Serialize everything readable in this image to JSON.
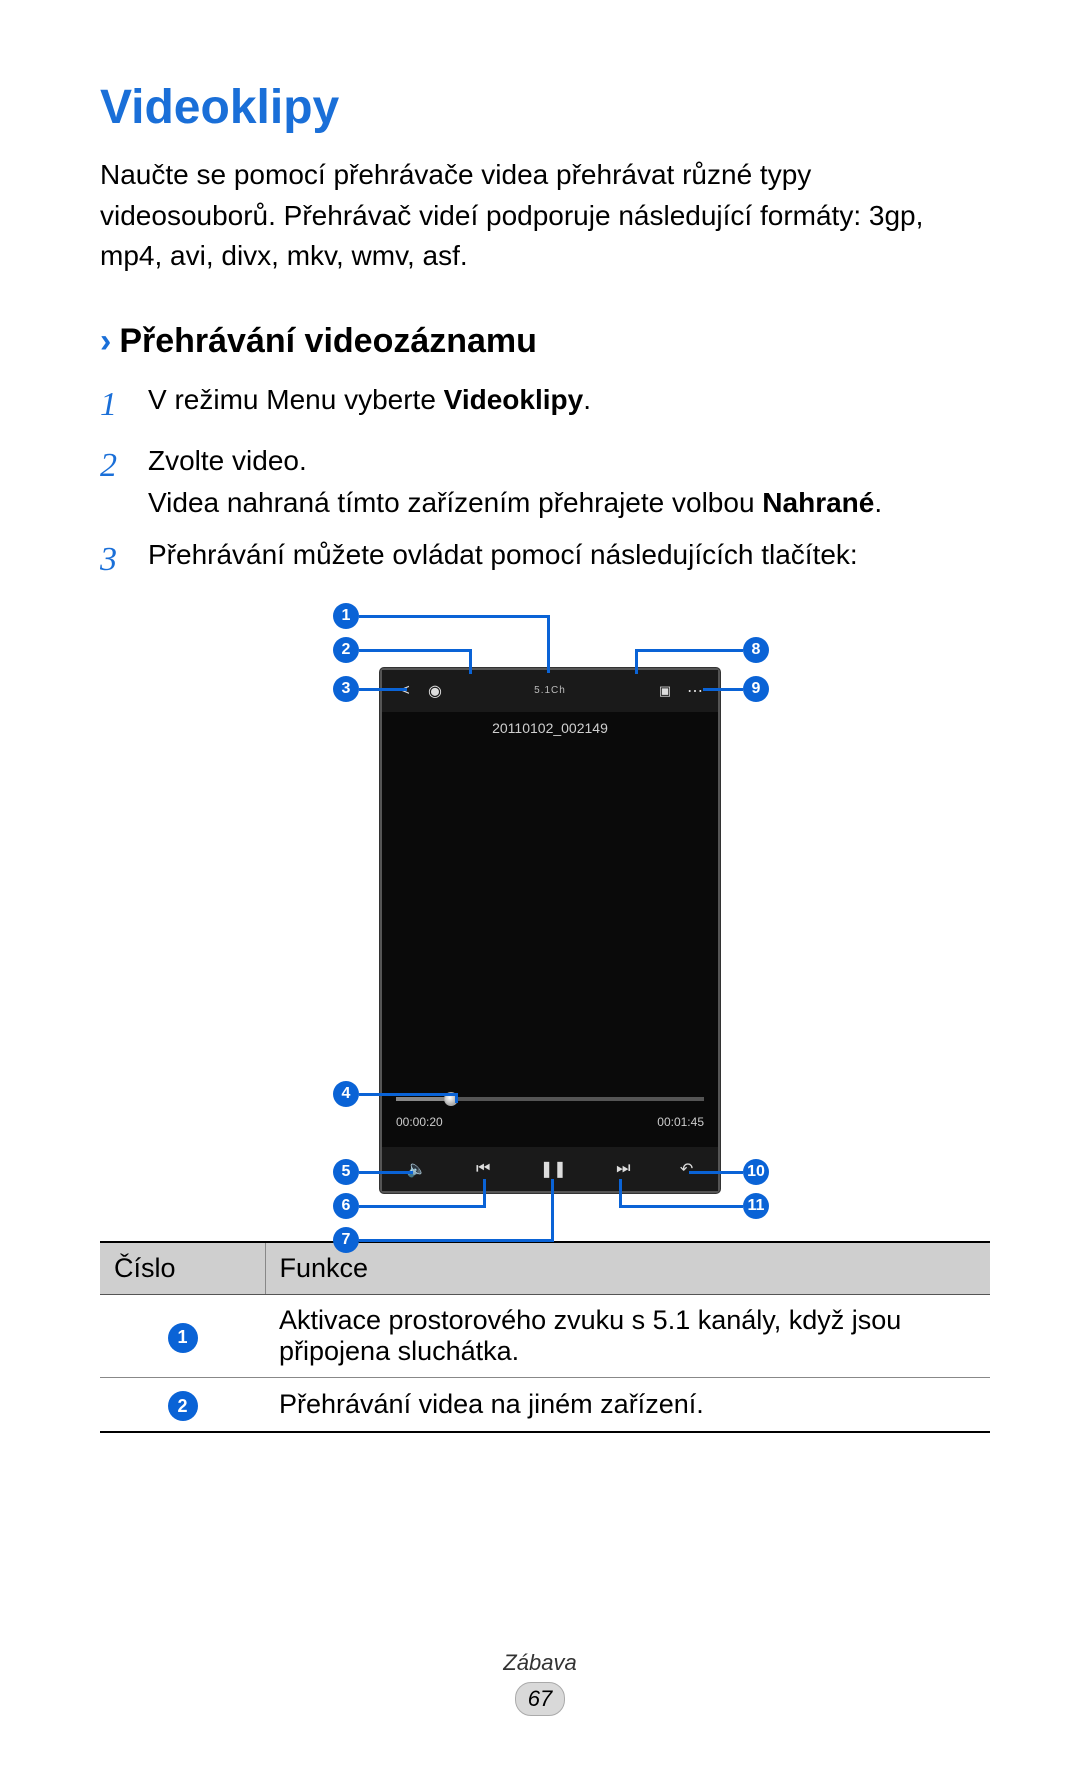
{
  "title": "Videoklipy",
  "intro": "Naučte se pomocí přehrávače videa přehrávat různé typy videosouborů. Přehrávač videí podporuje následující formáty: 3gp, mp4, avi, divx, mkv, wmv, asf.",
  "subhead": "Přehrávání videozáznamu",
  "steps": {
    "s1_a": "V režimu Menu vyberte ",
    "s1_b": "Videoklipy",
    "s1_c": ".",
    "s2_a": "Zvolte video.",
    "s2_b": "Videa nahraná tímto zařízením přehrajete volbou ",
    "s2_c": "Nahrané",
    "s2_d": ".",
    "s3": "Přehrávání můžete ovládat pomocí následujících tlačítek:"
  },
  "phone": {
    "filename": "20110102_002149",
    "surround_label": "5.1Ch",
    "time_current": "00:00:20",
    "time_total": "00:01:45"
  },
  "callouts": {
    "c1": "1",
    "c2": "2",
    "c3": "3",
    "c4": "4",
    "c5": "5",
    "c6": "6",
    "c7": "7",
    "c8": "8",
    "c9": "9",
    "c10": "10",
    "c11": "11"
  },
  "table": {
    "head_num": "Číslo",
    "head_func": "Funkce",
    "rows": [
      {
        "n": "1",
        "f": "Aktivace prostorového zvuku s 5.1 kanály, když jsou připojena sluchátka."
      },
      {
        "n": "2",
        "f": "Přehrávání videa na jiném zařízení."
      }
    ]
  },
  "footer": {
    "category": "Zábava",
    "page": "67"
  }
}
